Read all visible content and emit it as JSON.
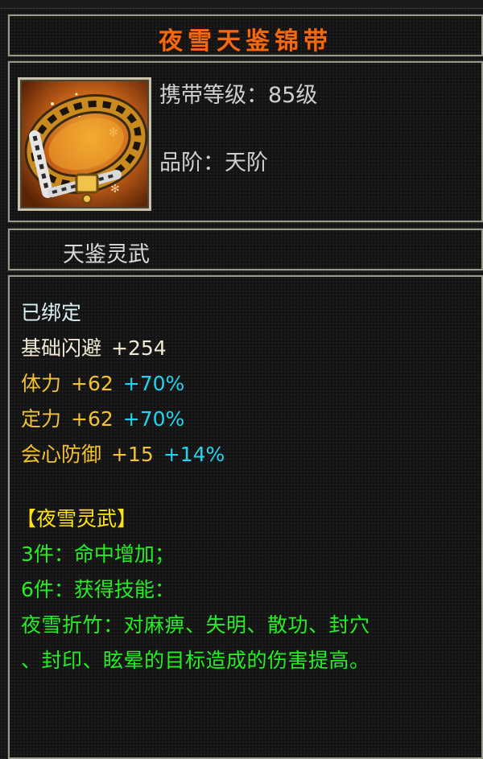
{
  "item": {
    "title": "夜雪天鉴锦带",
    "required_level": "携带等级：85级",
    "grade": "品阶：天阶",
    "name": "天鉴灵武",
    "icon": "golden-belt-icon"
  },
  "attributes": {
    "bound": "已绑定",
    "base_dodge": {
      "label": "基础闪避",
      "value": "+254"
    },
    "stamina": {
      "label": "体力",
      "value": "+62",
      "bonus": "+70%"
    },
    "focus": {
      "label": "定力",
      "value": "+62",
      "bonus": "+70%"
    },
    "crit_defense": {
      "label": "会心防御",
      "value": "+15",
      "bonus": "+14%"
    }
  },
  "set": {
    "name": "【夜雪灵武】",
    "bonus_3": "3件：命中增加；",
    "bonus_6": "6件：获得技能：",
    "skill_line1": "夜雪折竹：对麻痹、失明、散功、封穴",
    "skill_line2": "、封印、眩晕的目标造成的伤害提高。"
  },
  "colors": {
    "title": "#f06a12",
    "base_text": "#f2e9d4",
    "stat_text": "#f2c234",
    "bonus_text": "#22d4ef",
    "set_name": "#ffe21a",
    "set_text": "#25ee25",
    "border": "#9a9a8a"
  }
}
